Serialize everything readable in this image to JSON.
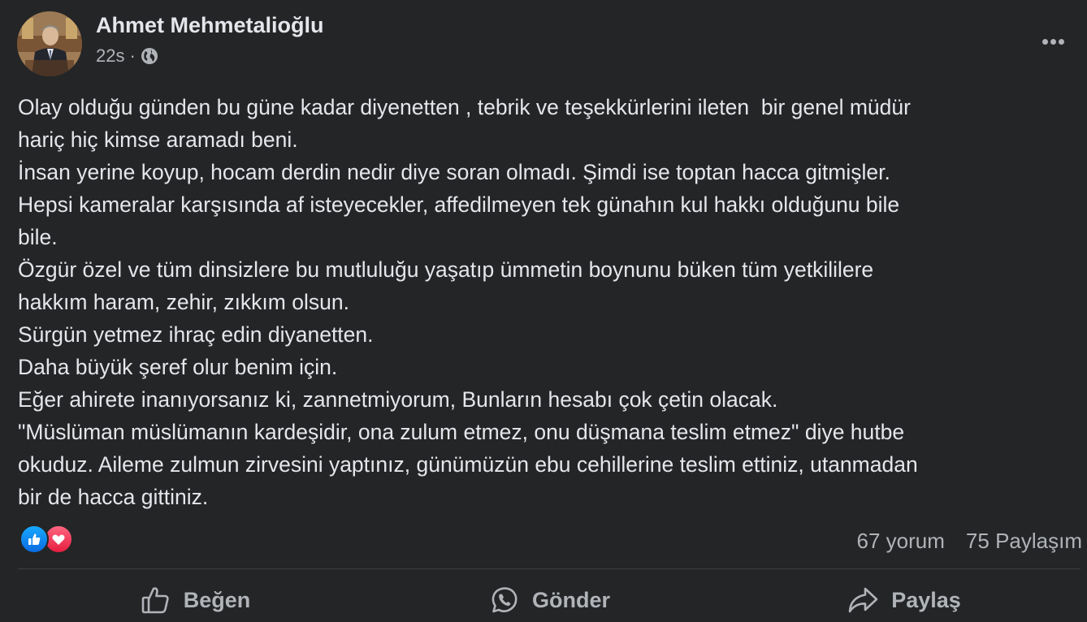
{
  "post": {
    "author": "Ahmet Mehmetalioğlu",
    "time": "22s",
    "separator": "·",
    "audience_icon": "globe-icon",
    "more_icon": "more-dots-icon",
    "body_lines": [
      "Olay olduğu günden bu güne kadar diyenetten , tebrik ve teşekkürlerini ileten  bir genel müdür",
      "hariç hiç kimse aramadı beni.",
      "İnsan yerine koyup, hocam derdin nedir diye soran olmadı. Şimdi ise toptan hacca gitmişler.",
      "Hepsi kameralar karşısında af isteyecekler, affedilmeyen tek günahın kul hakkı olduğunu bile",
      "bile.",
      "Özgür özel ve tüm dinsizlere bu mutluluğu yaşatıp ümmetin boynunu büken tüm yetkililere",
      "hakkım haram, zehir, zıkkım olsun.",
      "Sürgün yetmez ihraç edin diyanetten.",
      "Daha büyük şeref olur benim için.",
      "Eğer ahirete inanıyorsanız ki, zannetmiyorum, Bunların hesabı çok çetin olacak.",
      "\"Müslüman müslümanın kardeşidir, ona zulum etmez, onu düşmana teslim etmez\" diye hutbe",
      "okuduz. Aileme zulmun zirvesini yaptınız, günümüzün ebu cehillerine teslim ettiniz, utanmadan",
      "bir de hacca gittiniz."
    ],
    "reactions": [
      "like-icon",
      "love-icon"
    ],
    "comments": "67 yorum",
    "shares": "75 Paylaşım"
  },
  "actions": {
    "like": {
      "label": "Beğen",
      "icon": "thumbs-up-icon"
    },
    "send": {
      "label": "Gönder",
      "icon": "whatsapp-icon"
    },
    "share": {
      "label": "Paylaş",
      "icon": "share-arrow-icon"
    }
  },
  "colors": {
    "background": "#242526",
    "text": "#e4e6eb",
    "secondary": "#b0b3b8",
    "like": "#1877f2",
    "love": "#f33e58"
  }
}
